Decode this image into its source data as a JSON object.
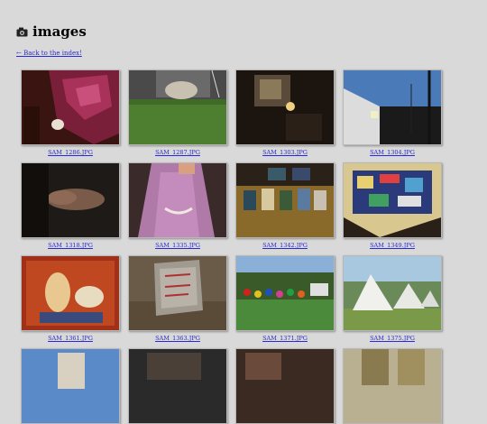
{
  "page": {
    "title": "images",
    "back_link": "← Back to the index!"
  },
  "icons": {
    "title_icon": "camera-icon"
  },
  "link_color": "#2a2ad0",
  "images": [
    {
      "caption": "SAM_1286.JPG"
    },
    {
      "caption": "SAM_1287.JPG"
    },
    {
      "caption": "SAM_1303.JPG"
    },
    {
      "caption": "SAM_1304.JPG"
    },
    {
      "caption": "SAM_1318.JPG"
    },
    {
      "caption": "SAM_1335.JPG"
    },
    {
      "caption": "SAM_1342.JPG"
    },
    {
      "caption": "SAM_1349.JPG"
    },
    {
      "caption": "SAM_1361.JPG"
    },
    {
      "caption": "SAM_1363.JPG"
    },
    {
      "caption": "SAM_1371.JPG"
    },
    {
      "caption": "SAM_1375.JPG"
    },
    {
      "caption": ""
    },
    {
      "caption": ""
    },
    {
      "caption": ""
    },
    {
      "caption": ""
    }
  ]
}
